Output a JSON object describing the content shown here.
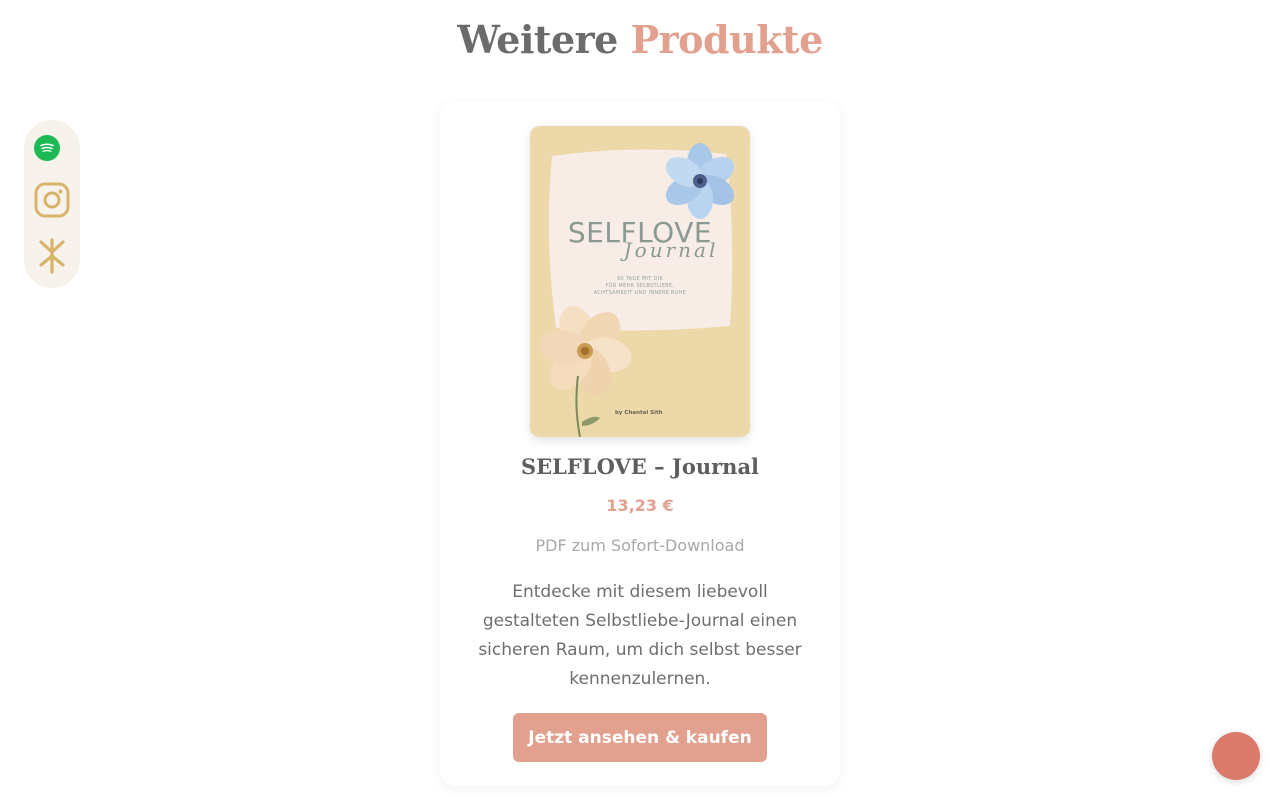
{
  "section": {
    "title_part_1": "Weitere ",
    "title_part_2": "Produkte"
  },
  "social": {
    "items": [
      {
        "icon": "spotify-icon",
        "color": "#1db954"
      },
      {
        "icon": "instagram-icon",
        "color": "#d8b46a"
      },
      {
        "icon": "linktree-icon",
        "color": "#d8b46a"
      }
    ]
  },
  "product": {
    "cover": {
      "title": "SELFLOVE",
      "script": "Journal",
      "subtitle_lines": [
        "90 TAGE MIT DIR",
        "FÜR MEHR SELBSTLIEBE,",
        "ACHTSAMKEIT UND INNERE RUHE"
      ],
      "author": "by Chantal Sith"
    },
    "name": "SELFLOVE – Journal",
    "price": "13,23 €",
    "format": "PDF zum Sofort-Download",
    "description": "Entdecke mit diesem liebevoll gestalteten Selbstliebe-Journal einen sicheren Raum, um dich selbst besser kennenzulernen.",
    "cta_label": "Jetzt ansehen & kaufen"
  },
  "colors": {
    "accent": "#e2a08f",
    "heading_gray": "#6b6b6b",
    "chat_bubble": "#d97a6a"
  }
}
